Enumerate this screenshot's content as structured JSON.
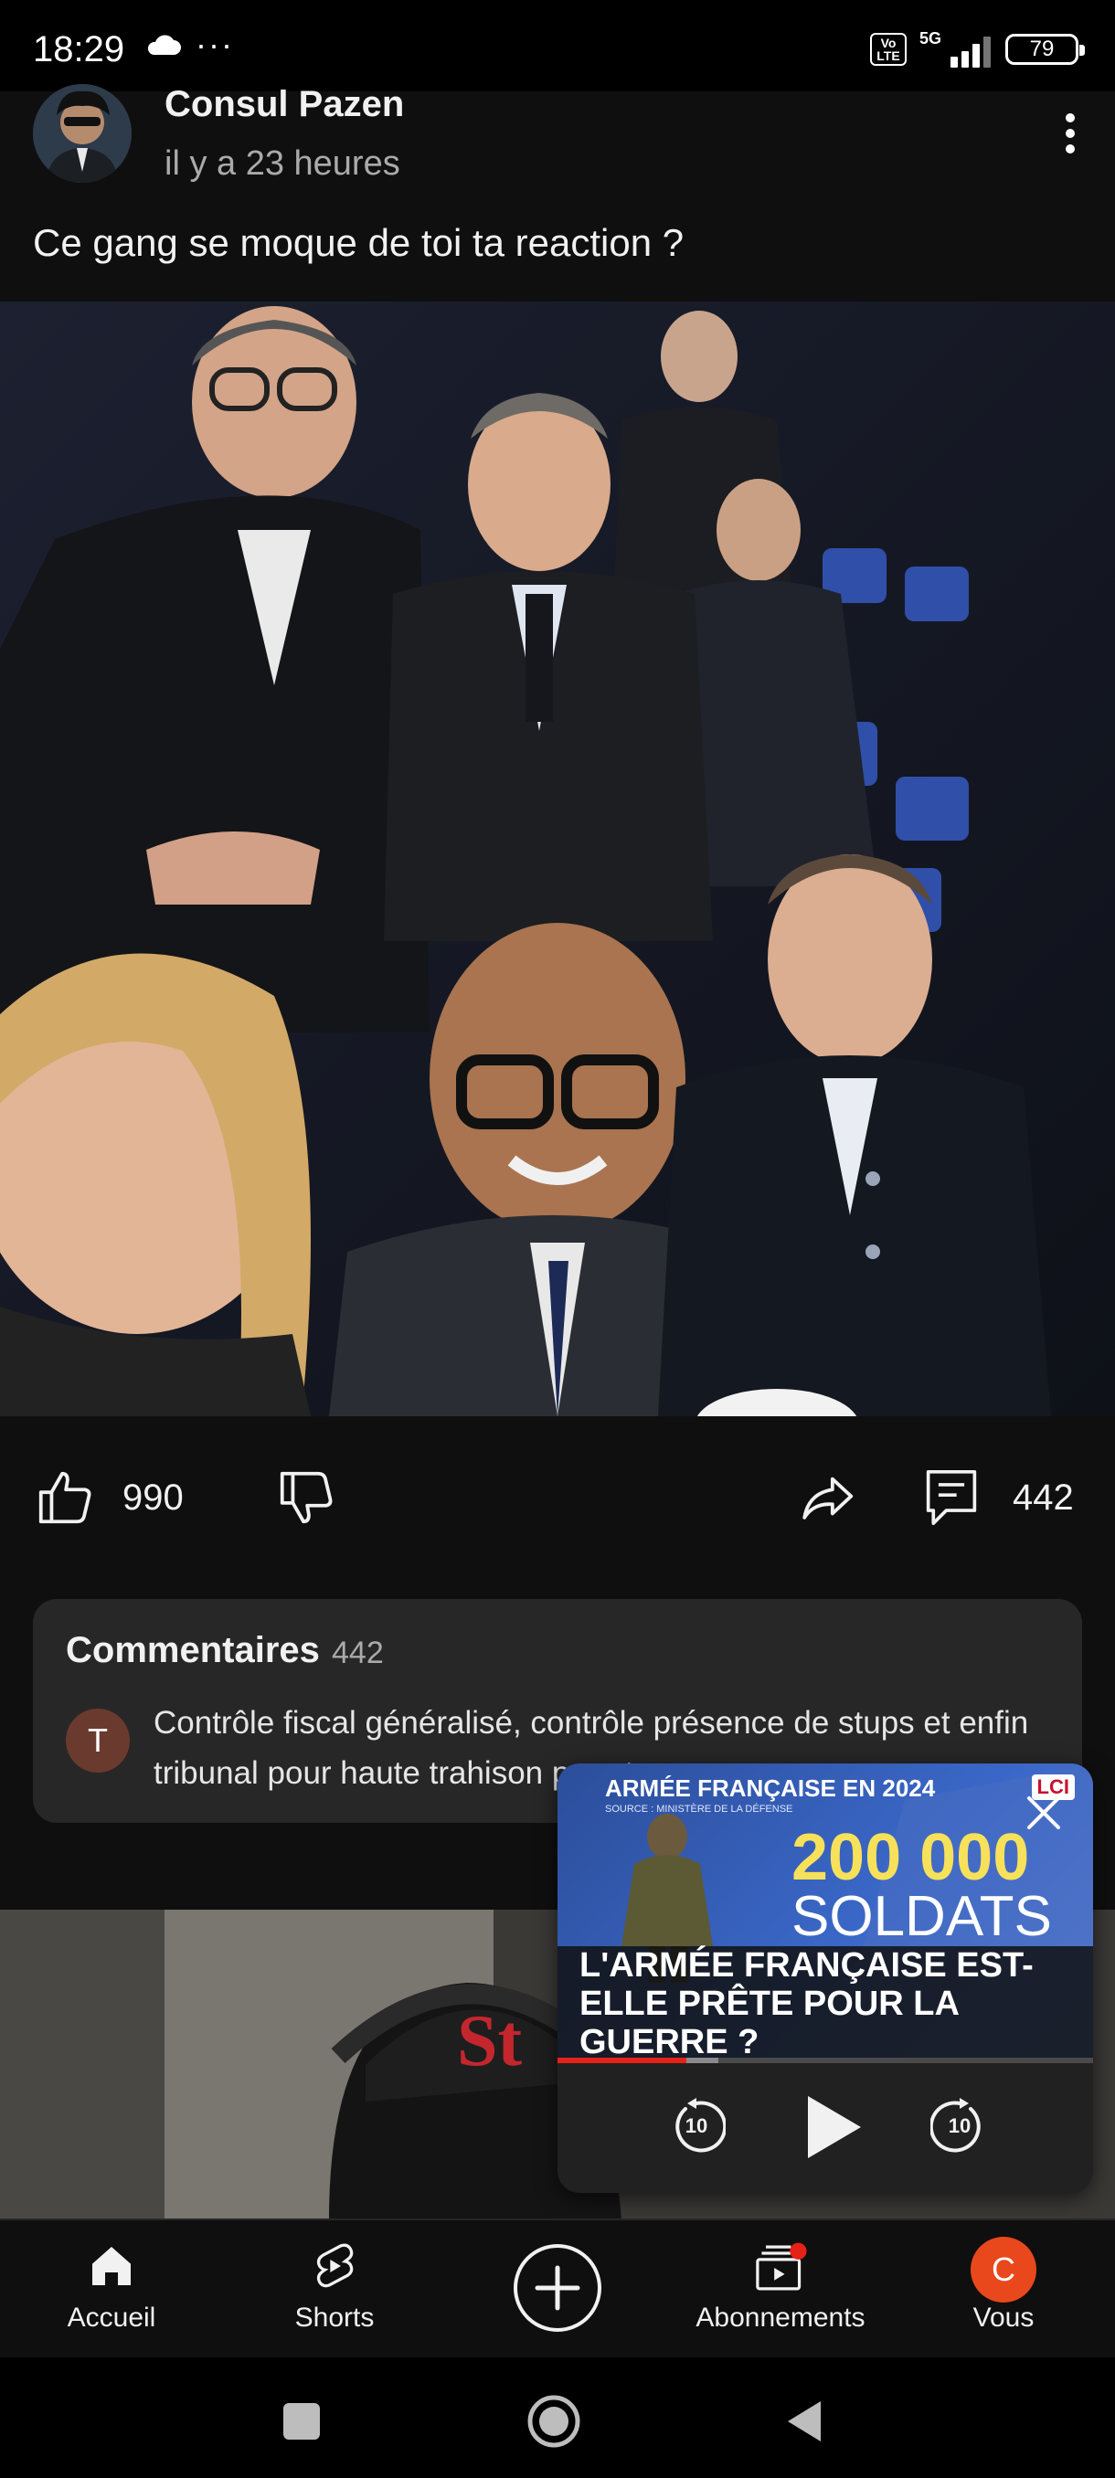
{
  "status_bar": {
    "time": "18:29",
    "network": "5G",
    "volte_badge": "Vo LTE",
    "battery": "79",
    "icons": [
      "cloud-icon",
      "more-dots-icon",
      "volte-icon",
      "signal-5g-icon",
      "battery-icon"
    ]
  },
  "post": {
    "channel_name": "Consul Pazen",
    "timestamp": "il y a 23 heures",
    "text": "Ce gang se moque de toi ta reaction ?",
    "image_description": "photo",
    "likes": "990",
    "comments_count": "442"
  },
  "comments": {
    "title": "Commentaires",
    "count": "442",
    "first_comment": {
      "avatar_letter": "T",
      "text": "Contrôle fiscal généralisé, contrôle présence de stups et enfin tribunal pour haute trahison pour tous"
    }
  },
  "mini_player": {
    "heading": "ARMÉE FRANÇAISE EN 2024",
    "source": "SOURCE : MINISTÈRE DE LA DÉFENSE",
    "channel_logo": "LCI",
    "big_number": "200 000",
    "big_unit": "SOLDATS",
    "headline": "L'ARMÉE FRANÇAISE EST-ELLE PRÊTE POUR LA GUERRE ?",
    "progress": 0.24,
    "buffered": 0.3,
    "rewind_label": "10",
    "forward_label": "10"
  },
  "bottom_nav": {
    "home": "Accueil",
    "shorts": "Shorts",
    "subscriptions": "Abonnements",
    "you": "Vous",
    "you_avatar_letter": "C"
  },
  "colors": {
    "background": "#0f0f0f",
    "card": "#272727",
    "accent_red": "#e62117",
    "avatar_orange": "#e8481c"
  }
}
